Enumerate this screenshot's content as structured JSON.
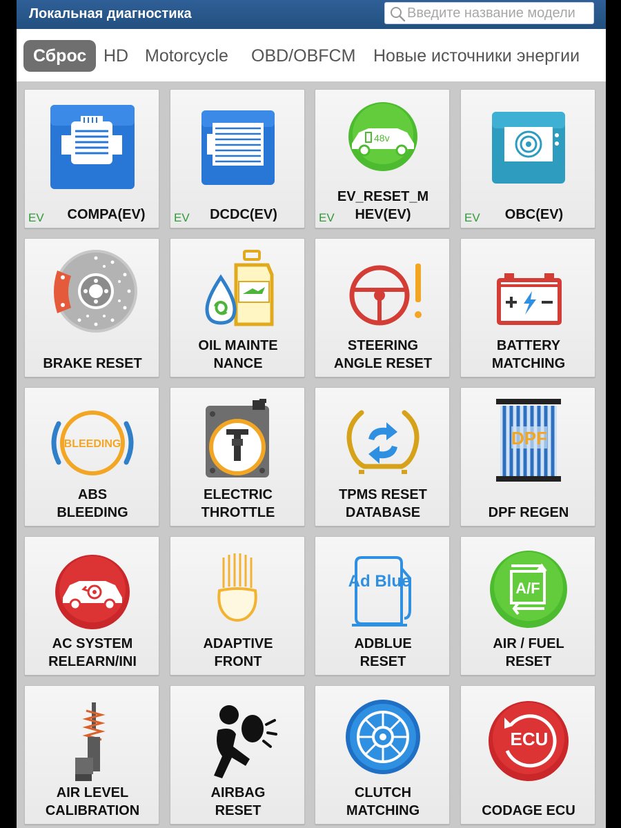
{
  "header": {
    "title": "Локальная диагностика",
    "search_placeholder": "Введите название модели",
    "search_value": ""
  },
  "tabs": [
    {
      "label": "Сброс",
      "active": true
    },
    {
      "label": "HD",
      "active": false
    },
    {
      "label": "Motorcycle",
      "active": false
    },
    {
      "label": "OBD/OBFCM",
      "active": false
    },
    {
      "label": "Новые источники энергии",
      "active": false
    }
  ],
  "tiles": [
    {
      "label": "COMPA(EV)",
      "icon": "ev-compressor-icon",
      "badge": "EV"
    },
    {
      "label": "DCDC(EV)",
      "icon": "dcdc-converter-icon",
      "badge": "EV"
    },
    {
      "label": "EV_RESET_M\nHEV(EV)",
      "icon": "ev-48v-car-icon",
      "icon_text": "48v",
      "badge": "EV"
    },
    {
      "label": "OBC(EV)",
      "icon": "onboard-charger-icon",
      "badge": "EV"
    },
    {
      "label": "BRAKE RESET",
      "icon": "brake-disc-icon"
    },
    {
      "label": "OIL MAINTE\nNANCE",
      "icon": "oil-bottle-icon"
    },
    {
      "label": "STEERING\nANGLE RESET",
      "icon": "steering-wheel-warning-icon"
    },
    {
      "label": "BATTERY\nMATCHING",
      "icon": "car-battery-icon"
    },
    {
      "label": "ABS\nBLEEDING",
      "icon": "abs-bleeding-icon",
      "icon_text": "BLEEDING"
    },
    {
      "label": "ELECTRIC\nTHROTTLE",
      "icon": "throttle-body-icon"
    },
    {
      "label": "TPMS RESET\nDATABASE",
      "icon": "tpms-tire-icon"
    },
    {
      "label": "DPF REGEN",
      "icon": "dpf-filter-icon",
      "icon_text": "DPF"
    },
    {
      "label": "AC SYSTEM\nRELEARN/INI",
      "icon": "ac-car-icon"
    },
    {
      "label": "ADAPTIVE\nFRONT",
      "icon": "headlight-icon"
    },
    {
      "label": "ADBLUE\nRESET",
      "icon": "adblue-pump-icon",
      "icon_text": "Ad Blue"
    },
    {
      "label": "AIR / FUEL\nRESET",
      "icon": "air-fuel-icon",
      "icon_text": "A/F"
    },
    {
      "label": "AIR LEVEL\nCALIBRATION",
      "icon": "air-suspension-icon"
    },
    {
      "label": "AIRBAG\nRESET",
      "icon": "airbag-icon"
    },
    {
      "label": "CLUTCH\nMATCHING",
      "icon": "clutch-disc-icon"
    },
    {
      "label": "CODAGE ECU",
      "icon": "ecu-coding-icon",
      "icon_text": "ECU"
    }
  ],
  "colors": {
    "header_bg": "#2a5b8f",
    "active_tab_bg": "#6f6f6f",
    "ev_badge": "#2f9a37"
  }
}
